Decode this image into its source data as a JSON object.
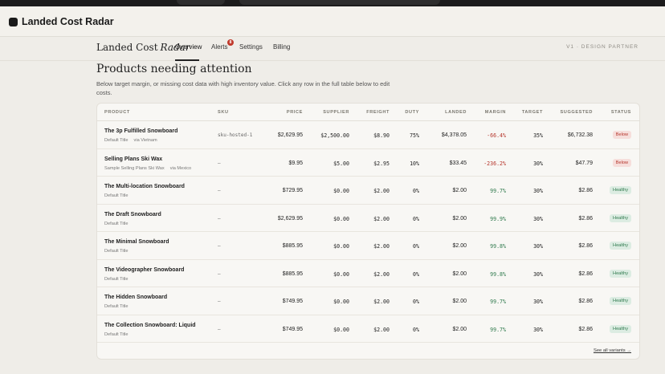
{
  "app": {
    "title": "Landed Cost Radar"
  },
  "nav": {
    "brand": "Landed Cost",
    "brand_accent": "Radar",
    "tabs": [
      {
        "label": "Overview",
        "active": true
      },
      {
        "label": "Alerts",
        "badge": "8"
      },
      {
        "label": "Settings"
      },
      {
        "label": "Billing"
      }
    ],
    "partner": "V1 · DESIGN PARTNER"
  },
  "section": {
    "title": "Products needing attention",
    "description": "Below target margin, or missing cost data with high inventory value. Click any row in the full table below to edit costs."
  },
  "table": {
    "headers": {
      "product": "PRODUCT",
      "sku": "SKU",
      "price": "PRICE",
      "supplier": "SUPPLIER",
      "freight": "FREIGHT",
      "duty": "DUTY",
      "landed": "LANDED",
      "margin": "MARGIN",
      "target": "TARGET",
      "suggested": "SUGGESTED",
      "status": "STATUS"
    },
    "rows": [
      {
        "name": "The 3p Fulfilled Snowboard",
        "variant": "Default Title",
        "country": "via Vietnam",
        "sku": "sku-hosted-1",
        "price": "$2,629.95",
        "supplier": "$2,500.00",
        "freight": "$8.90",
        "duty": "75%",
        "landed": "$4,378.05",
        "margin": "-66.4%",
        "target": "35%",
        "suggested": "$6,732.38",
        "status": "Below"
      },
      {
        "name": "Selling Plans Ski Wax",
        "variant": "Sample Selling Plans Ski Wax",
        "country": "via Mexico",
        "sku": "—",
        "price": "$9.95",
        "supplier": "$5.00",
        "freight": "$2.95",
        "duty": "10%",
        "landed": "$33.45",
        "margin": "-236.2%",
        "target": "30%",
        "suggested": "$47.79",
        "status": "Below"
      },
      {
        "name": "The Multi-location Snowboard",
        "variant": "Default Title",
        "country": "",
        "sku": "—",
        "price": "$729.95",
        "supplier": "$0.00",
        "freight": "$2.00",
        "duty": "0%",
        "landed": "$2.00",
        "margin": "99.7%",
        "target": "30%",
        "suggested": "$2.86",
        "status": "Healthy"
      },
      {
        "name": "The Draft Snowboard",
        "variant": "Default Title",
        "country": "",
        "sku": "—",
        "price": "$2,629.95",
        "supplier": "$0.00",
        "freight": "$2.00",
        "duty": "0%",
        "landed": "$2.00",
        "margin": "99.9%",
        "target": "30%",
        "suggested": "$2.86",
        "status": "Healthy"
      },
      {
        "name": "The Minimal Snowboard",
        "variant": "Default Title",
        "country": "",
        "sku": "—",
        "price": "$885.95",
        "supplier": "$0.00",
        "freight": "$2.00",
        "duty": "0%",
        "landed": "$2.00",
        "margin": "99.8%",
        "target": "30%",
        "suggested": "$2.86",
        "status": "Healthy"
      },
      {
        "name": "The Videographer Snowboard",
        "variant": "Default Title",
        "country": "",
        "sku": "—",
        "price": "$885.95",
        "supplier": "$0.00",
        "freight": "$2.00",
        "duty": "0%",
        "landed": "$2.00",
        "margin": "99.8%",
        "target": "30%",
        "suggested": "$2.86",
        "status": "Healthy"
      },
      {
        "name": "The Hidden Snowboard",
        "variant": "Default Title",
        "country": "",
        "sku": "—",
        "price": "$749.95",
        "supplier": "$0.00",
        "freight": "$2.00",
        "duty": "0%",
        "landed": "$2.00",
        "margin": "99.7%",
        "target": "30%",
        "suggested": "$2.86",
        "status": "Healthy"
      },
      {
        "name": "The Collection Snowboard: Liquid",
        "variant": "Default Title",
        "country": "",
        "sku": "—",
        "price": "$749.95",
        "supplier": "$0.00",
        "freight": "$2.00",
        "duty": "0%",
        "landed": "$2.00",
        "margin": "99.7%",
        "target": "30%",
        "suggested": "$2.86",
        "status": "Healthy"
      }
    ],
    "see_all": "See all variants →"
  },
  "colors": {
    "below": "#b5342a",
    "healthy": "#2f7a4d",
    "badge": "#c0392b"
  }
}
